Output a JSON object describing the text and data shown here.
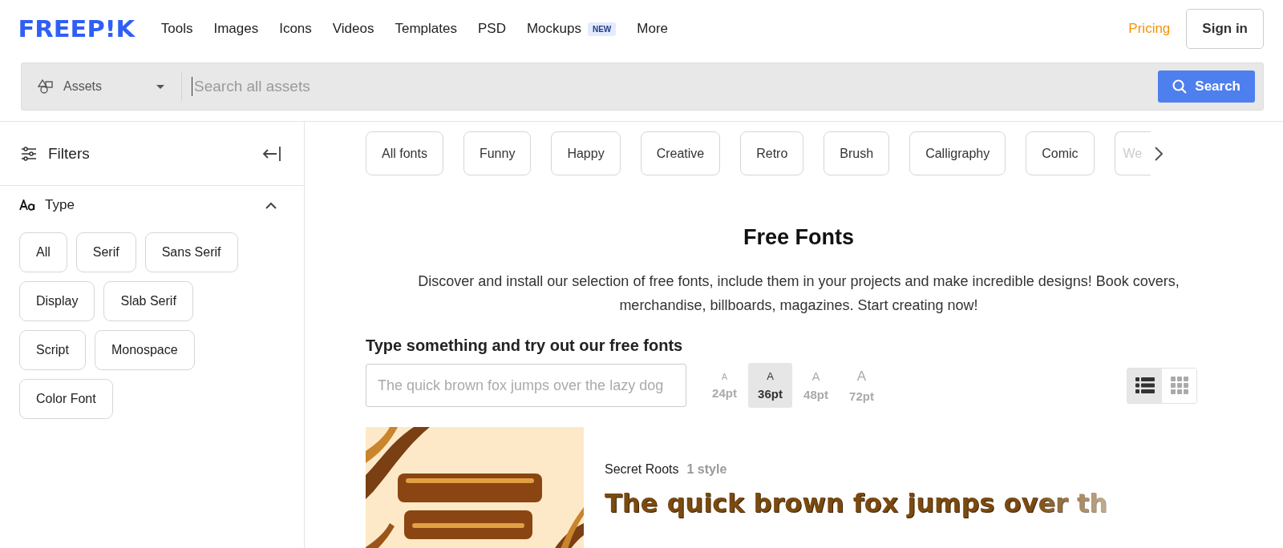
{
  "header": {
    "logo": "FREEP!K",
    "nav": [
      {
        "label": "Tools"
      },
      {
        "label": "Images"
      },
      {
        "label": "Icons"
      },
      {
        "label": "Videos"
      },
      {
        "label": "Templates"
      },
      {
        "label": "PSD"
      },
      {
        "label": "Mockups",
        "badge": "NEW"
      },
      {
        "label": "More"
      }
    ],
    "pricing": "Pricing",
    "sign_in": "Sign in"
  },
  "search": {
    "category": "Assets",
    "placeholder": "Search all assets",
    "button": "Search"
  },
  "sidebar": {
    "title": "Filters",
    "section": {
      "title": "Type",
      "expanded": true,
      "options": [
        {
          "label": "All",
          "selected": false
        },
        {
          "label": "Serif",
          "selected": false
        },
        {
          "label": "Sans Serif",
          "selected": false
        },
        {
          "label": "Display",
          "selected": false
        },
        {
          "label": "Slab Serif",
          "selected": false
        },
        {
          "label": "Script",
          "selected": false
        },
        {
          "label": "Monospace",
          "selected": false
        },
        {
          "label": "Color Font",
          "selected": false
        }
      ]
    }
  },
  "categories": [
    {
      "label": "All fonts",
      "faded": false
    },
    {
      "label": "Funny",
      "faded": false
    },
    {
      "label": "Happy",
      "faded": false
    },
    {
      "label": "Creative",
      "faded": false
    },
    {
      "label": "Retro",
      "faded": false
    },
    {
      "label": "Brush",
      "faded": false
    },
    {
      "label": "Calligraphy",
      "faded": false
    },
    {
      "label": "Comic",
      "faded": false
    },
    {
      "label": "We",
      "faded": true
    }
  ],
  "intro": {
    "title": "Free Fonts",
    "text": "Discover and install our selection of free fonts, include them in your projects and make incredible designs! Book covers, merchandise, billboards, magazines. Start creating now!"
  },
  "tester": {
    "title": "Type something and try out our free fonts",
    "placeholder": "The quick brown fox jumps over the lazy dog",
    "sizes": [
      {
        "letter": "A",
        "label": "24pt",
        "selected": false
      },
      {
        "letter": "A",
        "label": "36pt",
        "selected": true
      },
      {
        "letter": "A",
        "label": "48pt",
        "selected": false
      },
      {
        "letter": "A",
        "label": "72pt",
        "selected": false
      }
    ],
    "views": [
      {
        "kind": "list",
        "selected": true
      },
      {
        "kind": "grid",
        "selected": false
      }
    ]
  },
  "fonts": [
    {
      "name": "Secret Roots",
      "styles": "1 style",
      "preview": "The quick brown fox jumps over th"
    }
  ]
}
